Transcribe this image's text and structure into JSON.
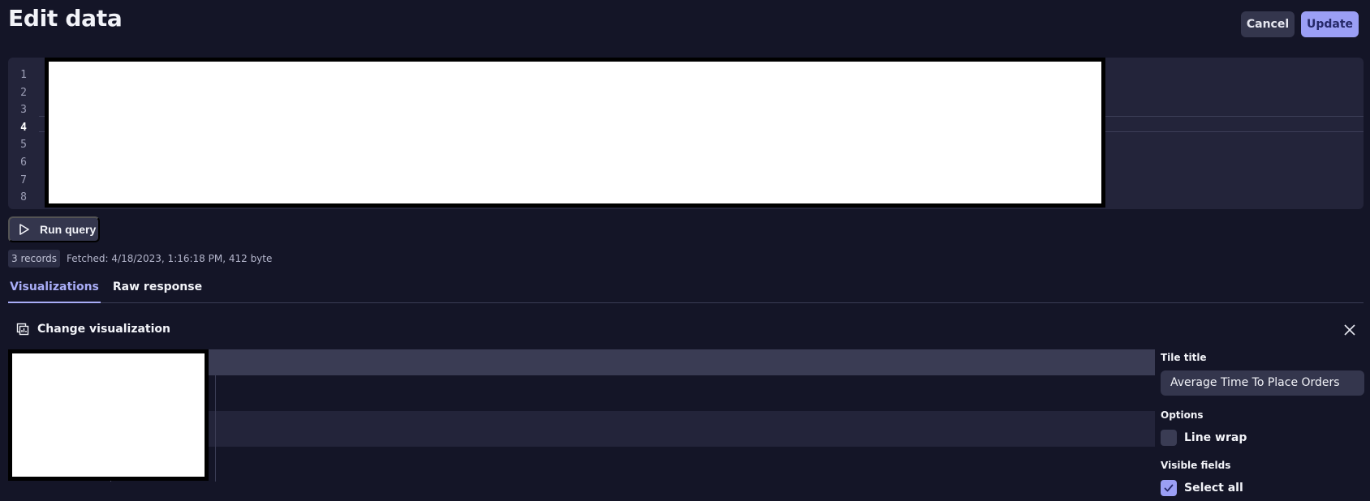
{
  "header": {
    "title": "Edit data",
    "cancel_label": "Cancel",
    "update_label": "Update"
  },
  "editor": {
    "line_numbers": [
      "1",
      "2",
      "3",
      "4",
      "5",
      "6",
      "7",
      "8"
    ],
    "active_line": "4"
  },
  "query": {
    "run_label": "Run query",
    "records_badge": "3 records",
    "fetched_text": "Fetched: 4/18/2023, 1:16:18 PM, 412 byte"
  },
  "tabs": [
    {
      "label": "Visualizations",
      "selected": true
    },
    {
      "label": "Raw response",
      "selected": false
    }
  ],
  "visualization": {
    "change_label": "Change visualization"
  },
  "side_panel": {
    "tile_title_label": "Tile title",
    "tile_title_value": "Average Time To Place Orders",
    "options_label": "Options",
    "line_wrap_label": "Line wrap",
    "line_wrap_checked": false,
    "visible_fields_label": "Visible fields",
    "select_all_label": "Select all",
    "select_all_checked": true
  },
  "colors": {
    "background": "#141527",
    "accent": "#9b9ff5",
    "panel": "#23243a"
  }
}
